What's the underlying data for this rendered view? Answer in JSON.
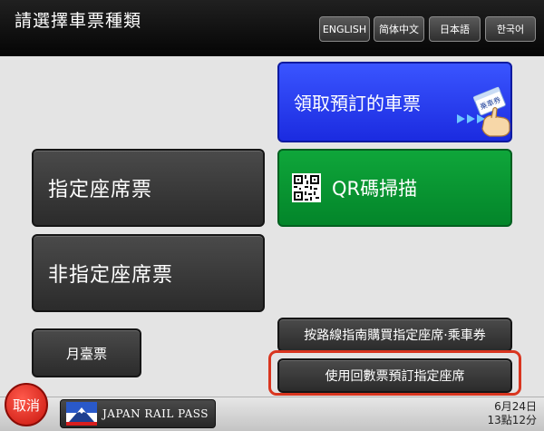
{
  "header": {
    "title": "請選擇車票種類",
    "languages": {
      "english": "ENGLISH",
      "simplified_chinese": "简体中文",
      "japanese": "日本語",
      "korean": "한국어"
    }
  },
  "main": {
    "pickup_reserved": "領取預訂的車票",
    "ticket_icon_label": "乗車券",
    "qr_scan": "QR碼掃描",
    "reserved_seat": "指定座席票",
    "non_reserved_seat": "非指定座席票",
    "platform_ticket": "月臺票",
    "route_guide": "按路線指南購買指定座席·乘車券",
    "coupon_reserve": "使用回數票預訂指定座席"
  },
  "footer": {
    "cancel": "取消",
    "jr_pass": "JAPAN RAIL PASS",
    "date": "6月24日",
    "time": "13點12分"
  },
  "colors": {
    "pickup_blue": "#1b2be0",
    "qr_green": "#03852a",
    "highlight_red": "#d9351f",
    "cancel_red": "#c8150d"
  },
  "icons": {
    "ticket": "ticket-hand-icon",
    "qr": "qr-code-icon",
    "jr_pass": "mount-fuji-icon"
  }
}
